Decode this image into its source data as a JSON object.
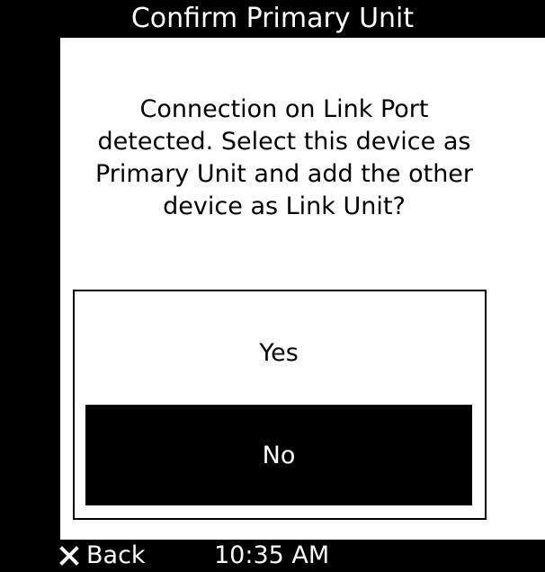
{
  "header": {
    "title": "Confirm Primary Unit"
  },
  "dialog": {
    "message": "Connection on Link Port detected. Select this device as Primary Unit and add the other device as Link Unit?",
    "options": [
      {
        "label": "Yes",
        "selected": false
      },
      {
        "label": "No",
        "selected": true
      }
    ]
  },
  "footer": {
    "back_label": "Back",
    "back_icon": "close-icon",
    "time": "10:35 AM"
  },
  "colors": {
    "background": "#000000",
    "panel": "#ffffff",
    "selected_option": "#000000",
    "selected_text": "#ffffff"
  }
}
